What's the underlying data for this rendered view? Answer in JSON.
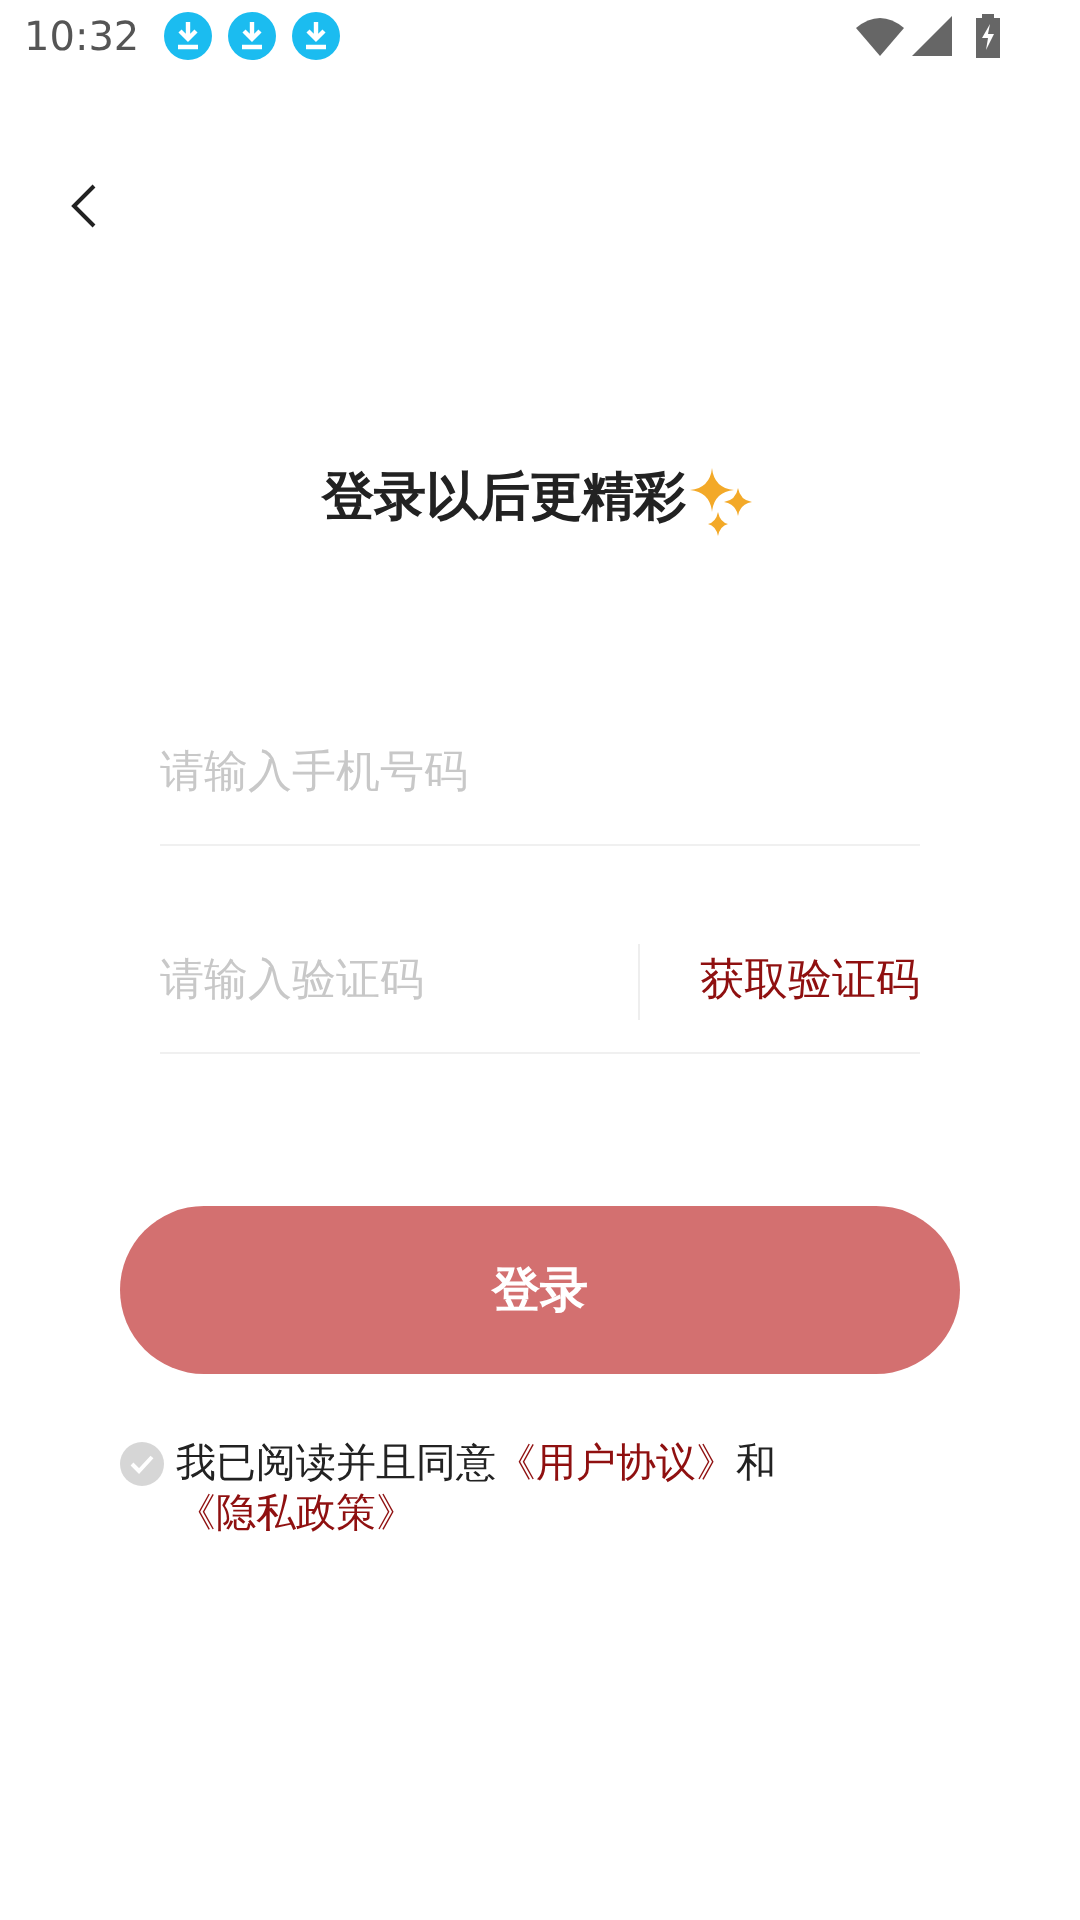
{
  "status_bar": {
    "time": "10:32",
    "notifications": [
      {
        "kind": "download"
      },
      {
        "kind": "download"
      },
      {
        "kind": "download"
      }
    ]
  },
  "title": "登录以后更精彩",
  "phone_field": {
    "placeholder": "请输入手机号码"
  },
  "code_field": {
    "placeholder": "请输入验证码",
    "action": "获取验证码"
  },
  "login_button": {
    "label": "登录",
    "disabled": true
  },
  "agreement": {
    "checked": false,
    "parts": [
      {
        "kind": "text",
        "text": "我已阅读并且同意"
      },
      {
        "kind": "link",
        "text": "《用户协议》"
      },
      {
        "kind": "text",
        "text": "和"
      },
      {
        "kind": "link",
        "text": "《隐私政策》"
      }
    ]
  }
}
